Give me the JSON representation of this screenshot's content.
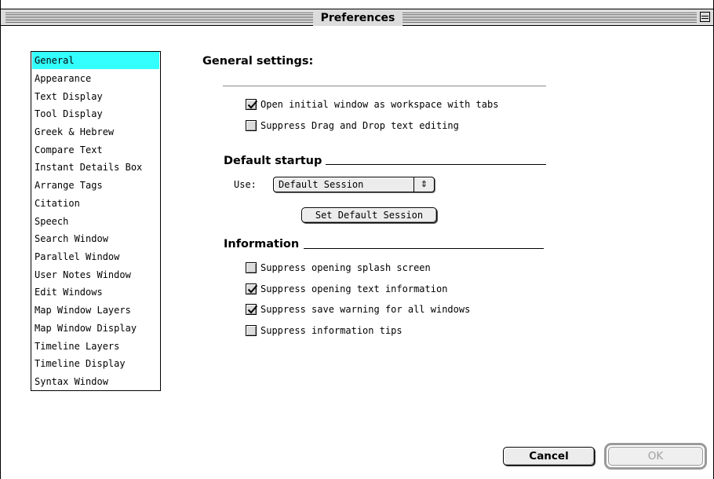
{
  "window": {
    "title": "Preferences"
  },
  "sidebar": {
    "items": [
      {
        "label": "General",
        "selected": true
      },
      {
        "label": "Appearance",
        "selected": false
      },
      {
        "label": "Text Display",
        "selected": false
      },
      {
        "label": "Tool Display",
        "selected": false
      },
      {
        "label": "Greek & Hebrew",
        "selected": false
      },
      {
        "label": "Compare Text",
        "selected": false
      },
      {
        "label": "Instant Details Box",
        "selected": false
      },
      {
        "label": "Arrange Tags",
        "selected": false
      },
      {
        "label": "Citation",
        "selected": false
      },
      {
        "label": "Speech",
        "selected": false
      },
      {
        "label": "Search Window",
        "selected": false
      },
      {
        "label": "Parallel Window",
        "selected": false
      },
      {
        "label": "User Notes Window",
        "selected": false
      },
      {
        "label": "Edit Windows",
        "selected": false
      },
      {
        "label": "Map Window Layers",
        "selected": false
      },
      {
        "label": "Map Window Display",
        "selected": false
      },
      {
        "label": "Timeline Layers",
        "selected": false
      },
      {
        "label": "Timeline Display",
        "selected": false
      },
      {
        "label": "Syntax Window",
        "selected": false
      }
    ],
    "selected_color": "#33ffff"
  },
  "general": {
    "heading": "General settings:",
    "options": [
      {
        "label": "Open initial window as workspace with tabs",
        "checked": true
      },
      {
        "label": "Suppress Drag and Drop text editing",
        "checked": false
      }
    ]
  },
  "startup": {
    "heading": "Default startup",
    "use_label": "Use:",
    "session_value": "Default Session",
    "popup_arrow": "⇕",
    "set_default_label": "Set Default Session"
  },
  "information": {
    "heading": "Information",
    "options": [
      {
        "label": "Suppress opening splash screen",
        "checked": false
      },
      {
        "label": "Suppress opening text information",
        "checked": true
      },
      {
        "label": "Suppress save warning for all windows",
        "checked": true
      },
      {
        "label": "Suppress information tips",
        "checked": false
      }
    ]
  },
  "buttons": {
    "cancel": "Cancel",
    "ok": "OK",
    "ok_enabled": false
  }
}
